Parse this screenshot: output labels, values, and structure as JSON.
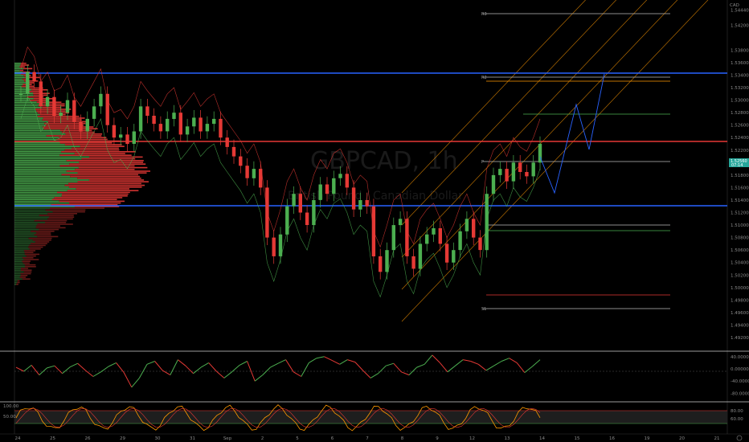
{
  "watermark": {
    "symbol": "GBPCAD, 1h",
    "description": "British Pound / Canadian Dollar"
  },
  "currency_label": "CAD",
  "last_price": {
    "value": "1.52560",
    "countdown": "07:14"
  },
  "pivots": {
    "r3": "R3",
    "r2": "R2",
    "p": "P",
    "s1": "S1"
  },
  "colors": {
    "up": "#4caf50",
    "down": "#e53935",
    "blue_level": "#2962ff",
    "red_level": "#e53935",
    "channel": "#ff9800",
    "projection": "#2962ff"
  },
  "chart_data": [
    {
      "type": "candlestick",
      "title": "GBPCAD, 1h",
      "y_ticks": [
        "1.54440",
        "1.54200",
        "1.53800",
        "1.53600",
        "1.53400",
        "1.53200",
        "1.53000",
        "1.52800",
        "1.52600",
        "1.52400",
        "1.52200",
        "1.52000",
        "1.51800",
        "1.51600",
        "1.51400",
        "1.51200",
        "1.51000",
        "1.50800",
        "1.50600",
        "1.50400",
        "1.50200",
        "1.50000",
        "1.49800",
        "1.49600",
        "1.49400",
        "1.49200"
      ],
      "ylim": [
        1.492,
        1.545
      ],
      "x_ticks": [
        "24",
        "25",
        "26",
        "29",
        "30",
        "31",
        "Sep",
        "2",
        "5",
        "6",
        "7",
        "8",
        "9",
        "12",
        "13",
        "14",
        "15",
        "16",
        "19",
        "20",
        "21"
      ],
      "close_series": [
        1.531,
        1.5345,
        1.533,
        1.529,
        1.5305,
        1.5275,
        1.528,
        1.53,
        1.5265,
        1.525,
        1.527,
        1.529,
        1.531,
        1.526,
        1.524,
        1.5245,
        1.523,
        1.525,
        1.529,
        1.5275,
        1.5262,
        1.525,
        1.527,
        1.528,
        1.5245,
        1.5258,
        1.5272,
        1.525,
        1.5262,
        1.527,
        1.524,
        1.5225,
        1.521,
        1.5195,
        1.5175,
        1.519,
        1.516,
        1.508,
        1.505,
        1.5085,
        1.513,
        1.515,
        1.512,
        1.51,
        1.514,
        1.5165,
        1.515,
        1.5175,
        1.5182,
        1.516,
        1.5125,
        1.514,
        1.513,
        1.505,
        1.5025,
        1.506,
        1.51,
        1.511,
        1.505,
        1.503,
        1.507,
        1.5085,
        1.5095,
        1.507,
        1.504,
        1.506,
        1.509,
        1.511,
        1.508,
        1.506,
        1.515,
        1.518,
        1.519,
        1.517,
        1.52,
        1.5185,
        1.5178,
        1.52,
        1.523
      ],
      "horizontal_levels": [
        {
          "name": "blue-resistance",
          "value": 1.5341
        },
        {
          "name": "red-level",
          "value": 1.5243
        },
        {
          "name": "blue-support",
          "value": 1.5144
        }
      ]
    },
    {
      "type": "line",
      "title": "",
      "y_ticks": [
        "40.00000",
        "0.00000",
        "-40.00000",
        "-80.00000"
      ],
      "ylim": [
        -100,
        50
      ],
      "values": [
        5,
        -8,
        12,
        -20,
        3,
        10,
        -15,
        6,
        18,
        -5,
        -25,
        -10,
        8,
        20,
        -12,
        -60,
        -30,
        15,
        25,
        -5,
        -20,
        30,
        10,
        -15,
        5,
        20,
        -8,
        -30,
        -10,
        12,
        25,
        -40,
        -20,
        5,
        18,
        30,
        -10,
        -25,
        20,
        35,
        40,
        28,
        15,
        30,
        22,
        -5,
        -30,
        -15,
        10,
        18,
        -10,
        -20,
        5,
        15,
        45,
        20,
        -10,
        10,
        30,
        25,
        15,
        -5,
        10,
        25,
        35,
        20,
        -12,
        8,
        30
      ]
    },
    {
      "type": "line",
      "title": "",
      "y_ticks": [
        "100.00",
        "50.00",
        "80.00",
        "60.00"
      ],
      "ylim": [
        0,
        100
      ]
    }
  ]
}
